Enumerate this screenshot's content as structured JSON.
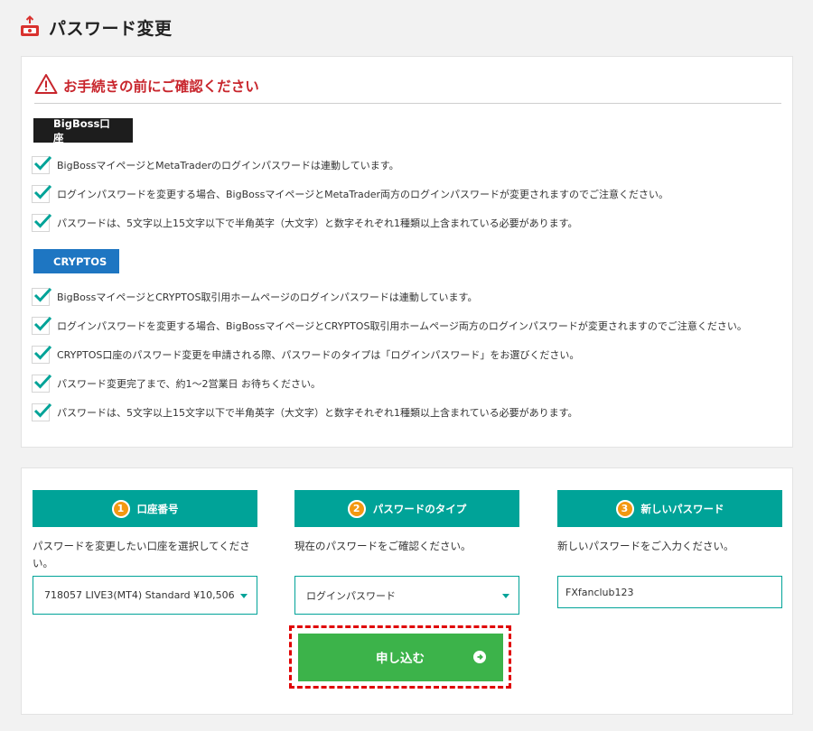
{
  "header": {
    "title": "パスワード変更"
  },
  "notice": {
    "title": "お手続きの前にご確認ください",
    "sections": [
      {
        "tag": "BigBoss口座",
        "items": [
          "BigBossマイページとMetaTraderのログインパスワードは連動しています。",
          "ログインパスワードを変更する場合、BigBossマイページとMetaTrader両方のログインパスワードが変更されますのでご注意ください。",
          "パスワードは、5文字以上15文字以下で半角英字（大文字）と数字それぞれ1種類以上含まれている必要があります。"
        ]
      },
      {
        "tag": "CRYPTOS",
        "items": [
          "BigBossマイページとCRYPTOS取引用ホームページのログインパスワードは連動しています。",
          "ログインパスワードを変更する場合、BigBossマイページとCRYPTOS取引用ホームページ両方のログインパスワードが変更されますのでご注意ください。",
          "CRYPTOS口座のパスワード変更を申請される際、パスワードのタイプは「ログインパスワード」をお選びください。",
          "パスワード変更完了まで、約1～2営業日 お待ちください。",
          "パスワードは、5文字以上15文字以下で半角英字（大文字）と数字それぞれ1種類以上含まれている必要があります。"
        ]
      }
    ]
  },
  "form": {
    "steps": [
      {
        "num": "1",
        "label": "口座番号",
        "desc": "パスワードを変更したい口座を選択してください。",
        "value": "718057 LIVE3(MT4) Standard ¥10,506"
      },
      {
        "num": "2",
        "label": "パスワードのタイプ",
        "desc": "現在のパスワードをご確認ください。",
        "value": "ログインパスワード"
      },
      {
        "num": "3",
        "label": "新しいパスワード",
        "desc": "新しいパスワードをご入力ください。",
        "value": "FXfanclub123"
      }
    ],
    "submit_label": "申し込む"
  },
  "colors": {
    "teal": "#00a398",
    "orange": "#f39811",
    "green": "#3cb34a",
    "red": "#c8252c",
    "blue": "#1e76c2"
  }
}
